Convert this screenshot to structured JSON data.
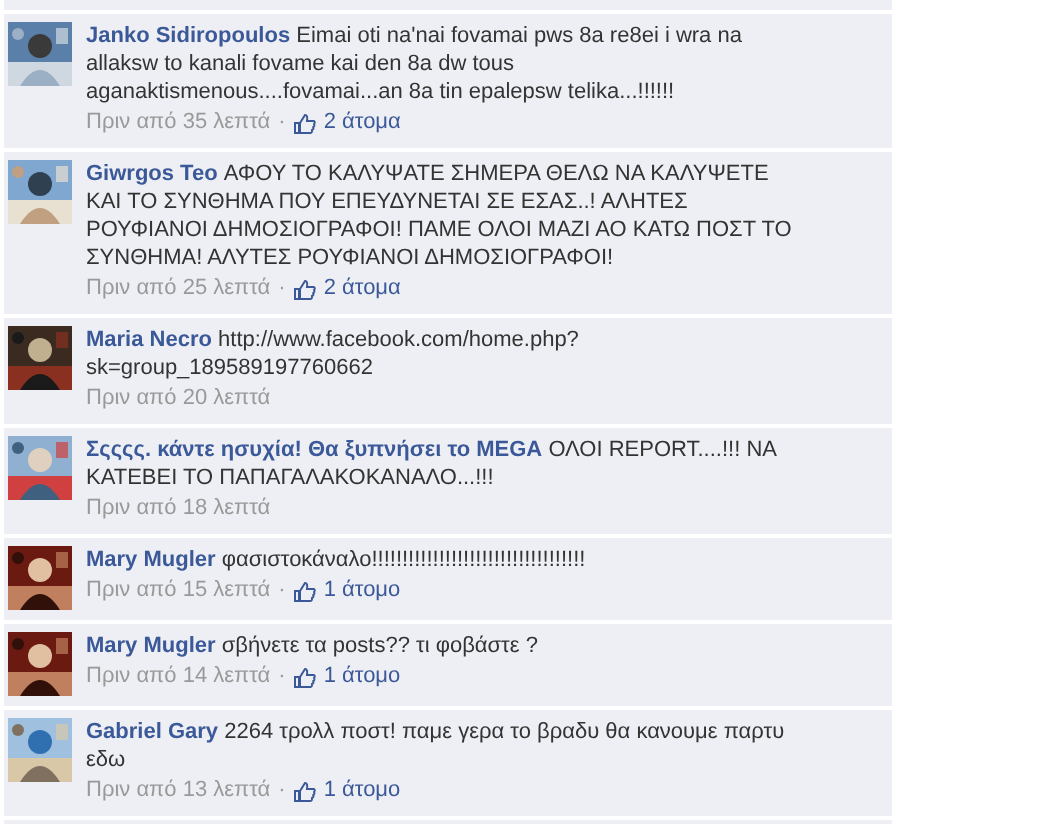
{
  "comments": [
    {
      "name": "Janko Sidiropoulos",
      "text": "Eimai oti na'nai fovamai pws 8a re8ei i wra na allaksw to kanali fovame kai den 8a dw tous aganaktismenous....fovamai...an 8a tin epalepsw telika...!!!!!!",
      "time": "Πριν από 35 λεπτά",
      "likes": {
        "separator": "·",
        "count": "2 άτομα"
      }
    },
    {
      "name": "Giwrgos Teo",
      "text": "ΑΦΟΥ ΤΟ ΚΑΛΥΨΑΤΕ ΣΗΜΕΡΑ ΘΕΛΩ ΝΑ ΚΑΛΥΨΕΤΕ ΚΑΙ ΤΟ ΣΥΝΘΗΜΑ ΠΟΥ ΕΠΕΥΔΥΝΕΤΑΙ ΣΕ ΕΣΑΣ..! ΑΛΗΤΕΣ ΡΟΥΦΙΑΝΟΙ ΔΗΜΟΣΙΟΓΡΑΦΟΙ! ΠΑΜΕ ΟΛΟΙ ΜΑΖΙ ΑΟ ΚΑΤΩ ΠΟΣΤ ΤΟ ΣΥΝΘΗΜΑ! ΑΛΥΤΕΣ ΡΟΥΦΙΑΝΟΙ ΔΗΜΟΣΙΟΓΡΑΦΟΙ!",
      "time": "Πριν από 25 λεπτά",
      "likes": {
        "separator": "·",
        "count": "2 άτομα"
      }
    },
    {
      "name": "Maria Necro",
      "text": "http://www.facebook.com/home.php?sk=group_189589197760662",
      "time": "Πριν από 20 λεπτά"
    },
    {
      "name": "Σςςςς. κάντε ησυχία! Θα ξυπνήσει το MEGA",
      "text": "ΟΛΟΙ REPORT....!!! ΝΑ ΚΑΤΕΒΕΙ ΤΟ ΠΑΠΑΓΑΛΑΚΟΚΑΝΑΛΟ...!!!",
      "time": "Πριν από 18 λεπτά"
    },
    {
      "name": "Mary Mugler",
      "text": "φασιστοκάναλο!!!!!!!!!!!!!!!!!!!!!!!!!!!!!!!!!!!",
      "time": "Πριν από 15 λεπτά",
      "likes": {
        "separator": "·",
        "count": "1 άτομο"
      }
    },
    {
      "name": "Mary Mugler",
      "text": "σβήνετε τα posts?? τι φοβάστε ?",
      "time": "Πριν από 14 λεπτά",
      "likes": {
        "separator": "·",
        "count": "1 άτομο"
      }
    },
    {
      "name": "Gabriel Gary",
      "text": "2264 τρολλ ποστ!  παμε γερα το βραδυ θα κανουμε παρτυ εδω",
      "time": "Πριν από 13 λεπτά",
      "likes": {
        "separator": "·",
        "count": "1 άτομο"
      }
    }
  ]
}
